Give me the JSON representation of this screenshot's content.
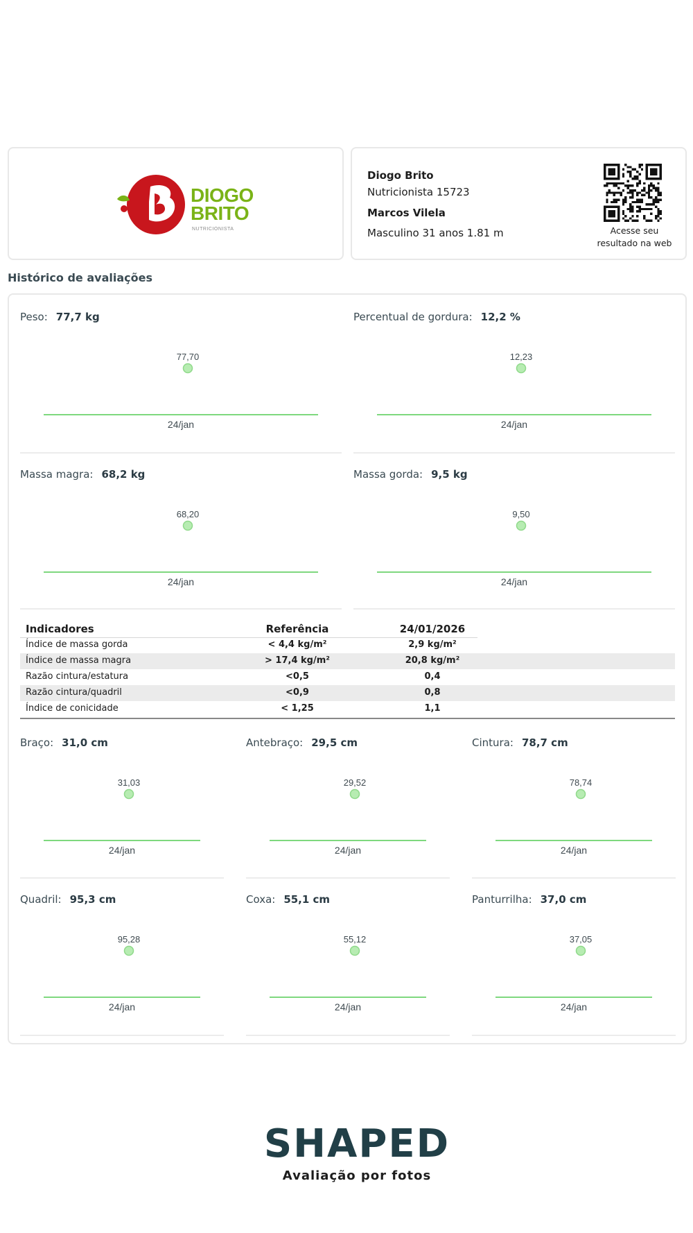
{
  "logo": {
    "line1": "DIOGO",
    "line2": "BRITO",
    "subtitle": "NUTRICIONISTA",
    "brand_red": "#c8161d",
    "brand_green": "#7ab317"
  },
  "professional": {
    "name": "Diogo Brito",
    "role": "Nutricionista 15723"
  },
  "patient": {
    "name": "Marcos Vilela",
    "details": "Masculino 31 anos 1.81 m"
  },
  "qr": {
    "caption_line1": "Acesse seu",
    "caption_line2": "resultado na web"
  },
  "section_title": "Histórico de avaliações",
  "accent_color": "#7ed87e",
  "chart_data": [
    {
      "type": "line",
      "title": "Peso:",
      "value_label": "77,7 kg",
      "x": [
        "24/jan"
      ],
      "values": [
        77.7
      ],
      "data_labels": [
        "77,70"
      ]
    },
    {
      "type": "line",
      "title": "Percentual de gordura:",
      "value_label": "12,2 %",
      "x": [
        "24/jan"
      ],
      "values": [
        12.23
      ],
      "data_labels": [
        "12,23"
      ]
    },
    {
      "type": "line",
      "title": "Massa magra:",
      "value_label": "68,2 kg",
      "x": [
        "24/jan"
      ],
      "values": [
        68.2
      ],
      "data_labels": [
        "68,20"
      ]
    },
    {
      "type": "line",
      "title": "Massa gorda:",
      "value_label": "9,5 kg",
      "x": [
        "24/jan"
      ],
      "values": [
        9.5
      ],
      "data_labels": [
        "9,50"
      ]
    },
    {
      "type": "line",
      "title": "Braço:",
      "value_label": "31,0 cm",
      "x": [
        "24/jan"
      ],
      "values": [
        31.03
      ],
      "data_labels": [
        "31,03"
      ]
    },
    {
      "type": "line",
      "title": "Antebraço:",
      "value_label": "29,5 cm",
      "x": [
        "24/jan"
      ],
      "values": [
        29.52
      ],
      "data_labels": [
        "29,52"
      ]
    },
    {
      "type": "line",
      "title": "Cintura:",
      "value_label": "78,7 cm",
      "x": [
        "24/jan"
      ],
      "values": [
        78.74
      ],
      "data_labels": [
        "78,74"
      ]
    },
    {
      "type": "line",
      "title": "Quadril:",
      "value_label": "95,3 cm",
      "x": [
        "24/jan"
      ],
      "values": [
        95.28
      ],
      "data_labels": [
        "95,28"
      ]
    },
    {
      "type": "line",
      "title": "Coxa:",
      "value_label": "55,1 cm",
      "x": [
        "24/jan"
      ],
      "values": [
        55.12
      ],
      "data_labels": [
        "55,12"
      ]
    },
    {
      "type": "line",
      "title": "Panturrilha:",
      "value_label": "37,0 cm",
      "x": [
        "24/jan"
      ],
      "values": [
        37.05
      ],
      "data_labels": [
        "37,05"
      ]
    }
  ],
  "indicators": {
    "headers": [
      "Indicadores",
      "Referência",
      "24/01/2026"
    ],
    "rows": [
      [
        "Índice de massa gorda",
        "< 4,4 kg/m²",
        "2,9 kg/m²"
      ],
      [
        "Índice de massa magra",
        "> 17,4 kg/m²",
        "20,8 kg/m²"
      ],
      [
        "Razão cintura/estatura",
        "<0,5",
        "0,4"
      ],
      [
        "Razão cintura/quadril",
        "<0,9",
        "0,8"
      ],
      [
        "Índice de conicidade",
        "< 1,25",
        "1,1"
      ]
    ]
  },
  "footer": {
    "brand": "SHAPED",
    "tagline": "Avaliação por fotos",
    "brand_color": "#213f47"
  }
}
